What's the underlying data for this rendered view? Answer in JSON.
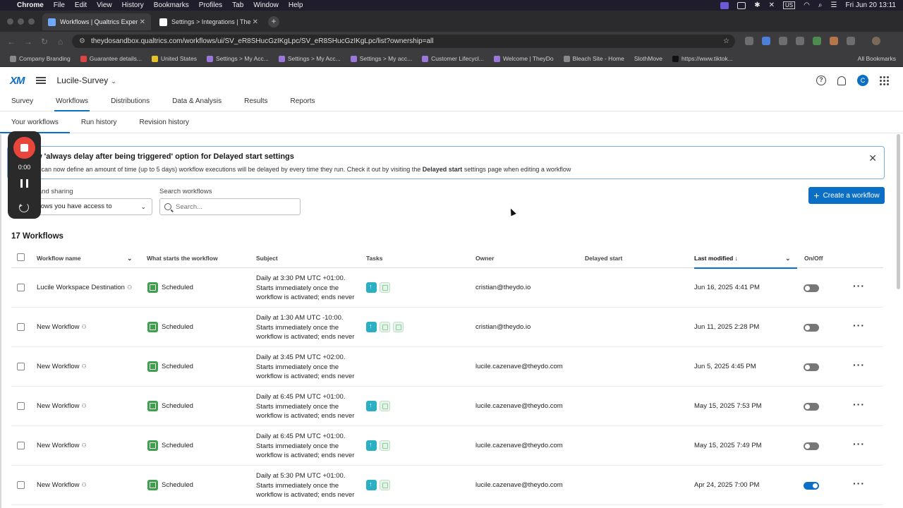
{
  "menubar": {
    "app": "Chrome",
    "items": [
      "File",
      "Edit",
      "View",
      "History",
      "Bookmarks",
      "Profiles",
      "Tab",
      "Window",
      "Help"
    ],
    "input_source": "US",
    "datetime": "Fri Jun 20  13:11"
  },
  "browser": {
    "tabs": [
      {
        "title": "Workflows | Qualtrics Experie",
        "active": true
      },
      {
        "title": "Settings > Integrations | They",
        "active": false
      }
    ],
    "url": "theydosandbox.qualtrics.com/workflows/ui/SV_eR8SHucGzIKgLpc/SV_eR8SHucGzIKgLpc/list?ownership=all",
    "bookmarks": [
      "Company Branding",
      "Guarantee details...",
      "United States",
      "Settings > My Acc...",
      "Settings > My Acc...",
      "Settings > My acc...",
      "Customer Lifecycl...",
      "Welcome | TheyDo",
      "Bleach Site - Home",
      "SlothMove",
      "https://www.tiktok..."
    ],
    "all_bookmarks": "All Bookmarks"
  },
  "header": {
    "logo": "XM",
    "project": "Lucile-Survey",
    "avatar_initial": "C"
  },
  "main_tabs": [
    "Survey",
    "Workflows",
    "Distributions",
    "Data & Analysis",
    "Results",
    "Reports"
  ],
  "sub_tabs": [
    "Your workflows",
    "Run history",
    "Revision history"
  ],
  "banner": {
    "title": "w 'always delay after being triggered' option for Delayed start settings",
    "body_pre": "u can now define an amount of time (up to 5 days) workflow executions will be delayed by every time they run. Check it out by visiting the ",
    "body_bold": "Delayed start",
    "body_post": " settings page when editing a workflow"
  },
  "filters": {
    "ownership_label": "p and sharing",
    "ownership_value": "flows you have access to",
    "search_label": "Search workflows",
    "search_placeholder": "Search..."
  },
  "create_button": "Create a workflow",
  "count_label": "17 Workflows",
  "columns": {
    "name": "Workflow name",
    "trigger": "What starts the workflow",
    "subject": "Subject",
    "tasks": "Tasks",
    "owner": "Owner",
    "delayed": "Delayed start",
    "modified": "Last modified",
    "onoff": "On/Off"
  },
  "rows": [
    {
      "name": "Lucile Workspace Destination",
      "trigger": "Scheduled",
      "subject": [
        "Daily at 3:30 PM UTC +01:00.",
        "Starts immediately once the",
        "workflow is activated; ends never"
      ],
      "owner": "cristian@theydo.io",
      "modified": "Jun 16, 2025 4:41 PM",
      "on": false
    },
    {
      "name": "New Workflow",
      "trigger": "Scheduled",
      "subject": [
        "Daily at 1:30 AM UTC -10:00.",
        "Starts immediately once the",
        "workflow is activated; ends never"
      ],
      "owner": "cristian@theydo.io",
      "modified": "Jun 11, 2025 2:28 PM",
      "on": false
    },
    {
      "name": "New Workflow",
      "trigger": "Scheduled",
      "subject": [
        "Daily at 3:45 PM UTC +02:00.",
        "Starts immediately once the",
        "workflow is activated; ends never"
      ],
      "owner": "lucile.cazenave@theydo.com",
      "modified": "Jun 5, 2025 4:45 PM",
      "on": false
    },
    {
      "name": "New Workflow",
      "trigger": "Scheduled",
      "subject": [
        "Daily at 6:45 PM UTC +01:00.",
        "Starts immediately once the",
        "workflow is activated; ends never"
      ],
      "owner": "lucile.cazenave@theydo.com",
      "modified": "May 15, 2025 7:53 PM",
      "on": false
    },
    {
      "name": "New Workflow",
      "trigger": "Scheduled",
      "subject": [
        "Daily at 6:45 PM UTC +01:00.",
        "Starts immediately once the",
        "workflow is activated; ends never"
      ],
      "owner": "lucile.cazenave@theydo.com",
      "modified": "May 15, 2025 7:49 PM",
      "on": false
    },
    {
      "name": "New Workflow",
      "trigger": "Scheduled",
      "subject": [
        "Daily at 5:30 PM UTC +01:00.",
        "Starts immediately once the",
        "workflow is activated; ends never"
      ],
      "owner": "lucile.cazenave@theydo.com",
      "modified": "Apr 24, 2025 7:00 PM",
      "on": true
    }
  ],
  "recorder": {
    "time": "0:00"
  },
  "colors": {
    "accent": "#0b6fc6",
    "scheduled": "#3ea04a",
    "task_upload": "#2ab0c2",
    "record": "#e8453c"
  }
}
